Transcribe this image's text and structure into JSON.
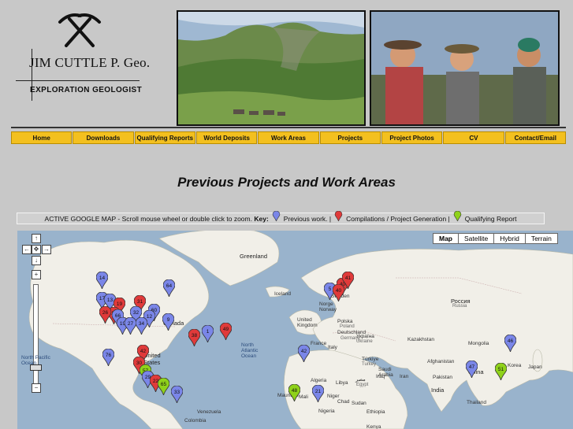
{
  "logo": {
    "name": "JIM CUTTLE P. Geo.",
    "title": "EXPLORATION GEOLOGIST",
    "icon": "crossed-pickaxes-icon"
  },
  "photos": {
    "left": "landscape-photo",
    "right": "team-photo"
  },
  "nav": [
    "Home",
    "Downloads",
    "Qualifying Reports",
    "World Deposits",
    "Work Areas",
    "Projects",
    "Project Photos",
    "CV",
    "Contact/Email"
  ],
  "heading": "Previous Projects and Work Areas",
  "keybar": {
    "intro": "ACTIVE GOOGLE MAP - Scroll mouse wheel or double click to zoom.",
    "key_label": "Key:",
    "previous": "Previous work. |",
    "compilations": "Compilations / Project Generation |",
    "qualifying": "Qualifying Report"
  },
  "colors": {
    "nav": "#f3c01f",
    "previous": "#7a86e8",
    "compilations": "#e03a3a",
    "qualifying": "#8fd21a",
    "water": "#99b3cc",
    "land": "#f1efe8"
  },
  "map": {
    "types": [
      "Map",
      "Satellite",
      "Hybrid",
      "Terrain"
    ],
    "active_type": "Map",
    "controls": {
      "up": "↑",
      "left": "←",
      "center": "✥",
      "right": "→",
      "down": "↓",
      "zoom_in": "+",
      "zoom_out": "−"
    },
    "labels": {
      "greenland": "Greenland",
      "iceland": "Iceland",
      "canada": "Canada",
      "united_states": "United\nStates",
      "north_atlantic": "North\nAtlantic\nOcean",
      "north_pacific": "North Pacific\nOcean",
      "united_kingdom": "United\nKingdom",
      "norway": "Norge\nNorway",
      "deutschland": "Deutschland",
      "germany": "Germany",
      "polska": "Polska",
      "poland": "Poland",
      "france": "France",
      "ukraine_native": "Україна",
      "ukraine": "Ukraine",
      "russia_native": "Россия",
      "russia": "Russia",
      "kazakhstan": "Kazakhstan",
      "mongolia": "Mongolia",
      "turkiye": "Türkiye",
      "turkey": "Turkey",
      "iraq": "Iraq",
      "iran": "Iran",
      "afghanistan": "Afghanistan",
      "pakistan": "Pakistan",
      "india": "India",
      "china": "China",
      "korea": "Korea",
      "japan": "Japan",
      "thailand": "Thailand",
      "algeria": "Algeria",
      "libya": "Libya",
      "egypt_native": "مصر",
      "egypt": "Egypt",
      "saudi_arabia": "Saudi\nArabia",
      "mali": "Mali",
      "mauritania": "Mauritani",
      "niger": "Niger",
      "chad": "Chad",
      "sudan": "Sudan",
      "nigeria": "Nigeria",
      "ethiopia": "Ethiopia",
      "kenya": "Kenya",
      "venezuela": "Venezuela",
      "colombia": "Colombia",
      "italy": "Italy",
      "sweden": "Sweden"
    },
    "pins": [
      {
        "n": "14",
        "type": "previous"
      },
      {
        "n": "64",
        "type": "previous"
      },
      {
        "n": "17",
        "type": "previous"
      },
      {
        "n": "13",
        "type": "previous"
      },
      {
        "n": "19",
        "type": "compilations"
      },
      {
        "n": "18",
        "type": "compilations"
      },
      {
        "n": "31",
        "type": "compilations"
      },
      {
        "n": "26",
        "type": "compilations"
      },
      {
        "n": "66",
        "type": "previous"
      },
      {
        "n": "32",
        "type": "previous"
      },
      {
        "n": "60",
        "type": "previous"
      },
      {
        "n": "12",
        "type": "previous"
      },
      {
        "n": "19",
        "type": "previous"
      },
      {
        "n": "27",
        "type": "previous"
      },
      {
        "n": "34",
        "type": "previous"
      },
      {
        "n": "9",
        "type": "previous"
      },
      {
        "n": "38",
        "type": "compilations"
      },
      {
        "n": "1",
        "type": "previous"
      },
      {
        "n": "49",
        "type": "compilations"
      },
      {
        "n": "42",
        "type": "compilations"
      },
      {
        "n": "30",
        "type": "compilations"
      },
      {
        "n": "57",
        "type": "qualifying"
      },
      {
        "n": "29",
        "type": "previous"
      },
      {
        "n": "22",
        "type": "compilations"
      },
      {
        "n": "65",
        "type": "qualifying"
      },
      {
        "n": "33",
        "type": "previous"
      },
      {
        "n": "76",
        "type": "previous"
      },
      {
        "n": "40",
        "type": "compilations"
      },
      {
        "n": "41",
        "type": "compilations"
      },
      {
        "n": "5",
        "type": "previous"
      },
      {
        "n": "40",
        "type": "compilations"
      },
      {
        "n": "42",
        "type": "previous"
      },
      {
        "n": "48",
        "type": "qualifying"
      },
      {
        "n": "21",
        "type": "previous"
      },
      {
        "n": "46",
        "type": "previous"
      },
      {
        "n": "47",
        "type": "previous"
      },
      {
        "n": "51",
        "type": "qualifying"
      }
    ]
  }
}
